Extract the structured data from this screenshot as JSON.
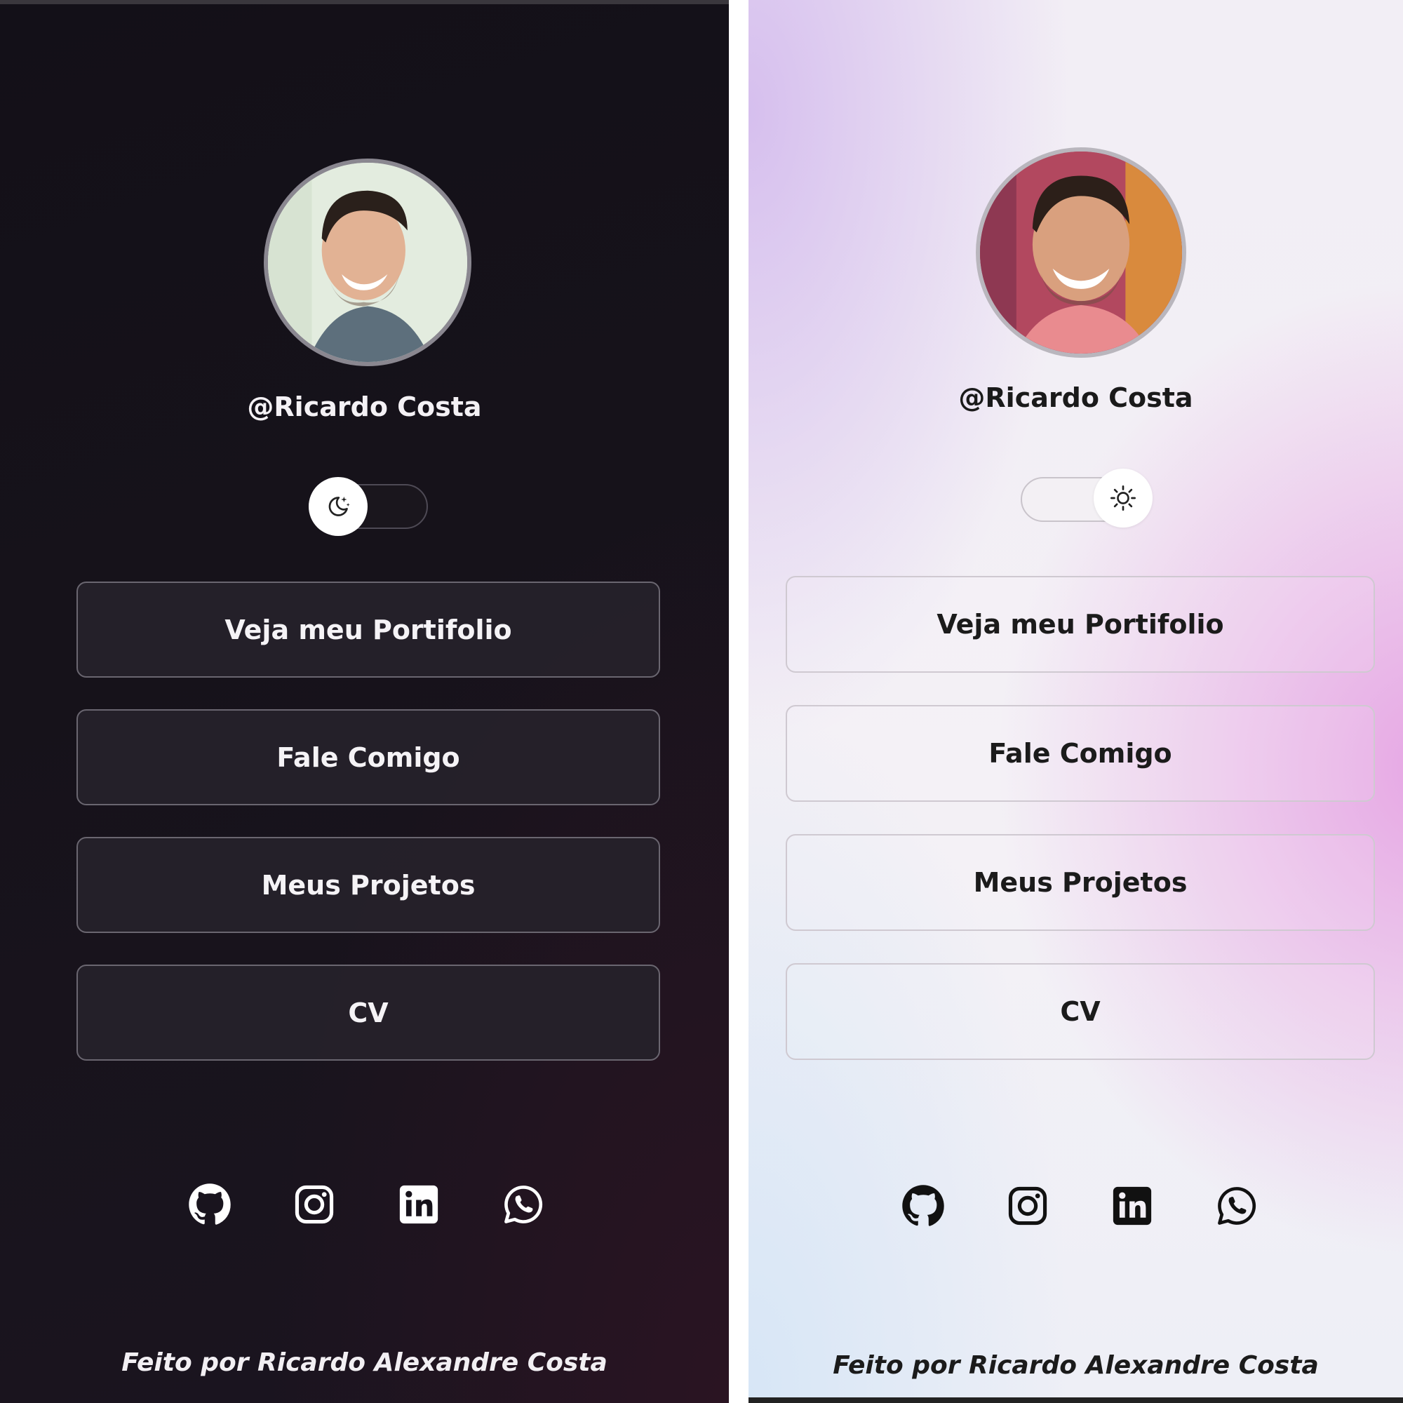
{
  "panels": [
    {
      "theme": "dark",
      "handle": "@Ricardo Costa",
      "toggle_icon": "moon-stars-icon",
      "buttons": [
        "Veja meu Portifolio",
        "Fale Comigo",
        "Meus Projetos",
        "CV"
      ],
      "socials": [
        "github-icon",
        "instagram-icon",
        "linkedin-icon",
        "whatsapp-icon"
      ],
      "footer": "Feito por Ricardo Alexandre Costa",
      "icon_color": "#ffffff"
    },
    {
      "theme": "light",
      "handle": "@Ricardo Costa",
      "toggle_icon": "sun-icon",
      "buttons": [
        "Veja meu Portifolio",
        "Fale Comigo",
        "Meus Projetos",
        "CV"
      ],
      "socials": [
        "github-icon",
        "instagram-icon",
        "linkedin-icon",
        "whatsapp-icon"
      ],
      "footer": "Feito por Ricardo Alexandre Costa",
      "icon_color": "#111111"
    }
  ]
}
